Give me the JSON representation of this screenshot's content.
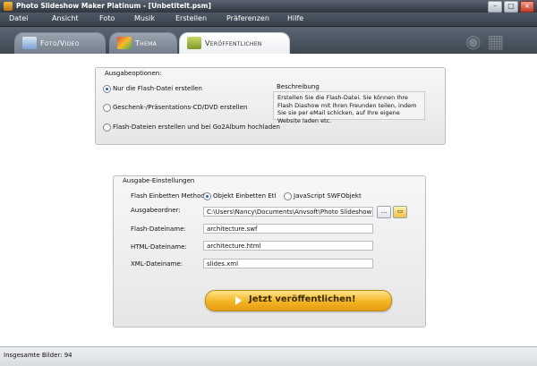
{
  "window": {
    "title": "Photo Slideshow Maker Platinum - [Unbetitelt.psm]"
  },
  "menu": [
    "Datei",
    "Ansicht",
    "Foto",
    "Musik",
    "Erstellen",
    "Präferenzen",
    "Hilfe"
  ],
  "tabs": [
    {
      "label": "Foto/Video",
      "active": false
    },
    {
      "label": "Thema",
      "active": false
    },
    {
      "label": "Veröffentlichen",
      "active": true
    }
  ],
  "output_options": {
    "legend": "Ausgabeoptionen:",
    "options": [
      {
        "label": "Nur die Flash-Datei erstellen",
        "selected": true
      },
      {
        "label": "Geschenk-/Präsentations-CD/DVD erstellen",
        "selected": false
      },
      {
        "label": "Flash-Dateien erstellen und bei Go2Album hochladen",
        "selected": false
      }
    ],
    "description": {
      "title": "Beschreibung",
      "text": "Erstellen Sie die Flash-Datei. Sie können Ihre Flash Diashow mit Ihren Freunden teilen, indem Sie sie per eMail schicken, auf Ihre eigene Website laden etc."
    }
  },
  "output_settings": {
    "legend": "Ausgabe-Einstellungen",
    "embed_method_label": "Flash Einbetten Methode:",
    "embed_options": [
      {
        "label": "Objekt Einbetten Etl",
        "selected": true
      },
      {
        "label": "JavaScript SWFObjekt",
        "selected": false
      }
    ],
    "folder_label": "Ausgabeordner:",
    "folder_value": "C:\\Users\\Nancy\\Documents\\Anvsoft\\Photo Slideshow Maker Plat",
    "browse_label": "...",
    "flash_label": "Flash-Dateiname:",
    "flash_value": "architecture.swf",
    "html_label": "HTML-Dateiname:",
    "html_value": "architecture.html",
    "xml_label": "XML-Dateiname:",
    "xml_value": "slides.xml"
  },
  "publish_button": "Jetzt veröffentlichen!",
  "status": "Insgesamte Bilder: 94",
  "colors": {
    "accent": "#f2b524",
    "titlebar": "#2f363f"
  }
}
